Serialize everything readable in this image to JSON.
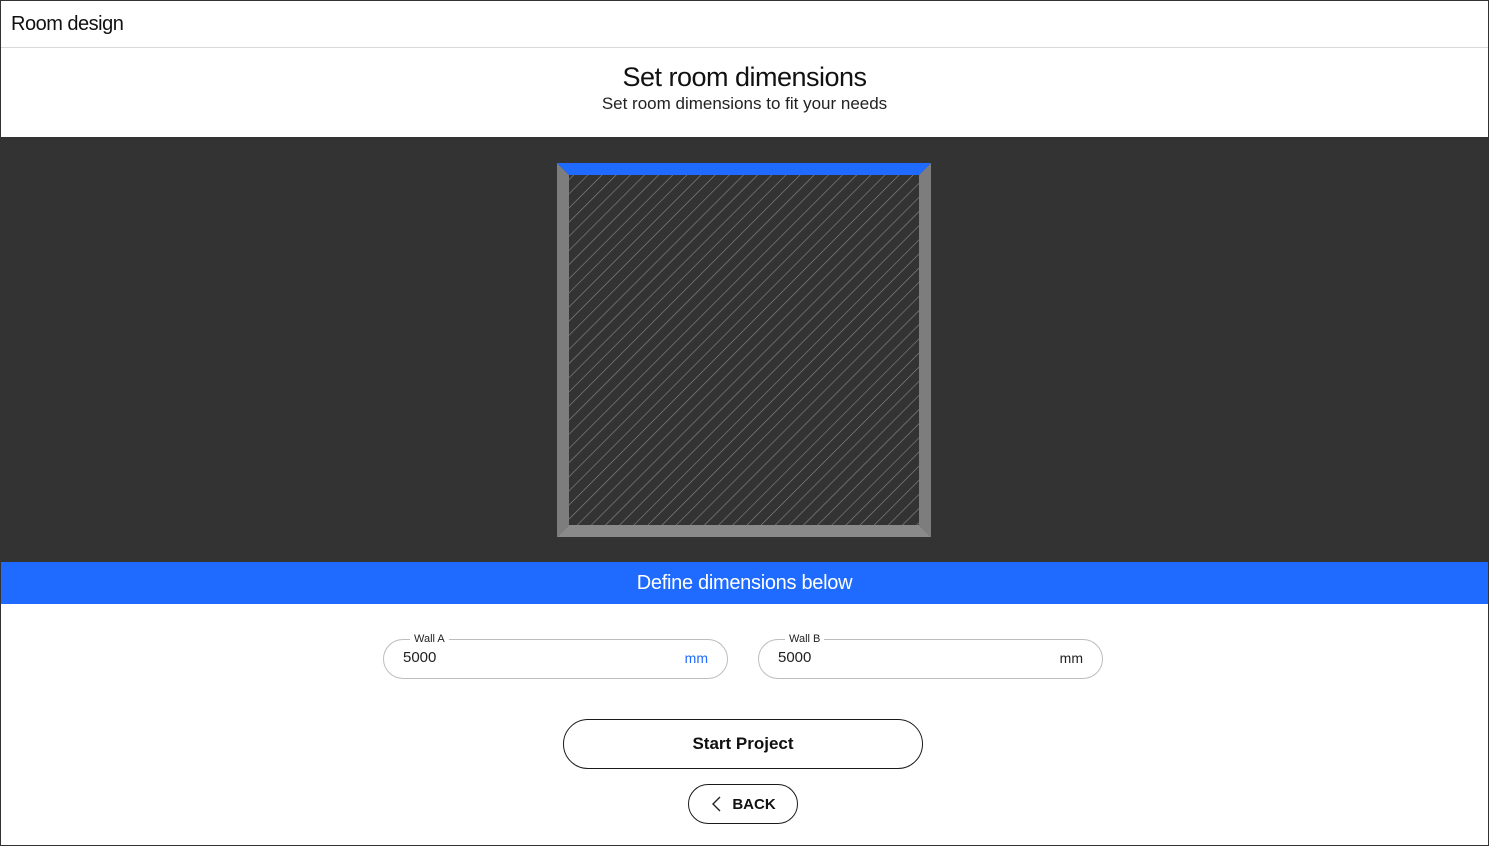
{
  "app": {
    "title": "Room design"
  },
  "header": {
    "title": "Set room dimensions",
    "subtitle": "Set room dimensions to fit your needs"
  },
  "room_preview": {
    "floor_color": "#333333",
    "wall_color": "#7a7a7a",
    "selected_wall_color": "#1f6bff",
    "hatch_color": "#8a8a8a",
    "selected_wall": "top"
  },
  "define_bar": {
    "label": "Define dimensions below",
    "color": "#1f6bff"
  },
  "fields": {
    "wall_a": {
      "label": "Wall A",
      "value": "5000",
      "unit": "mm"
    },
    "wall_b": {
      "label": "Wall B",
      "value": "5000",
      "unit": "mm"
    }
  },
  "actions": {
    "start_label": "Start Project",
    "back_label": "BACK",
    "back_icon": "chevron-left-icon"
  }
}
